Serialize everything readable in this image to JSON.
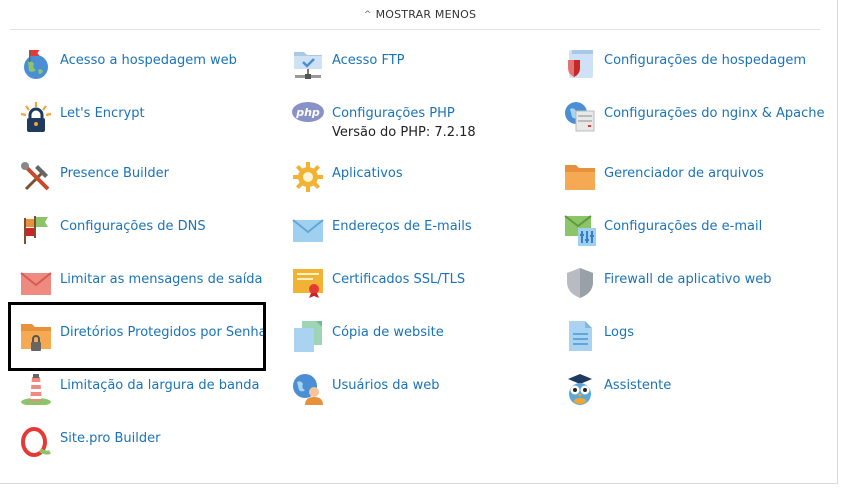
{
  "toggle": {
    "label": "MOSTRAR MENOS"
  },
  "tools": [
    {
      "id": "acesso-hospedagem",
      "label": "Acesso a hospedagem web",
      "icon": "globe-flag-icon"
    },
    {
      "id": "acesso-ftp",
      "label": "Acesso FTP",
      "icon": "ftp-folder-icon"
    },
    {
      "id": "config-hospedagem",
      "label": "Configurações de hospedagem",
      "icon": "hosting-settings-icon"
    },
    {
      "id": "lets-encrypt",
      "label": "Let's Encrypt",
      "icon": "lets-encrypt-icon"
    },
    {
      "id": "config-php",
      "label": "Configurações PHP",
      "sub": "Versão do PHP: 7.2.18",
      "icon": "php-icon"
    },
    {
      "id": "config-nginx",
      "label": "Configurações do nginx & Apache",
      "icon": "nginx-apache-icon"
    },
    {
      "id": "presence-builder",
      "label": "Presence Builder",
      "icon": "tools-icon"
    },
    {
      "id": "aplicativos",
      "label": "Aplicativos",
      "icon": "gear-icon"
    },
    {
      "id": "gerenciador-arquivos",
      "label": "Gerenciador de arquivos",
      "icon": "folder-icon"
    },
    {
      "id": "config-dns",
      "label": "Configurações de DNS",
      "icon": "dns-flags-icon"
    },
    {
      "id": "enderecos-email",
      "label": "Endereços de E-mails",
      "icon": "envelope-icon"
    },
    {
      "id": "config-email",
      "label": "Configurações de e-mail",
      "icon": "mail-settings-icon"
    },
    {
      "id": "limitar-mensagens",
      "label": "Limitar as mensagens de saída",
      "icon": "red-envelope-icon"
    },
    {
      "id": "certificados-ssl",
      "label": "Certificados SSL/TLS",
      "icon": "certificate-icon"
    },
    {
      "id": "firewall",
      "label": "Firewall de aplicativo web",
      "icon": "shield-icon"
    },
    {
      "id": "diretorios-protegidos",
      "label": "Diretórios Protegidos por Senha",
      "icon": "locked-folder-icon"
    },
    {
      "id": "copia-website",
      "label": "Cópia de website",
      "icon": "copy-icon"
    },
    {
      "id": "logs",
      "label": "Logs",
      "icon": "log-file-icon"
    },
    {
      "id": "limitacao-banda",
      "label": "Limitação da largura de banda",
      "icon": "lighthouse-icon"
    },
    {
      "id": "usuarios-web",
      "label": "Usuários da web",
      "icon": "web-user-icon"
    },
    {
      "id": "assistente",
      "label": "Assistente",
      "icon": "owl-icon"
    },
    {
      "id": "sitepro",
      "label": "Site.pro Builder",
      "icon": "sitepro-icon"
    }
  ],
  "colors": {
    "link": "#1a73b9",
    "highlight_border": "#000000"
  }
}
